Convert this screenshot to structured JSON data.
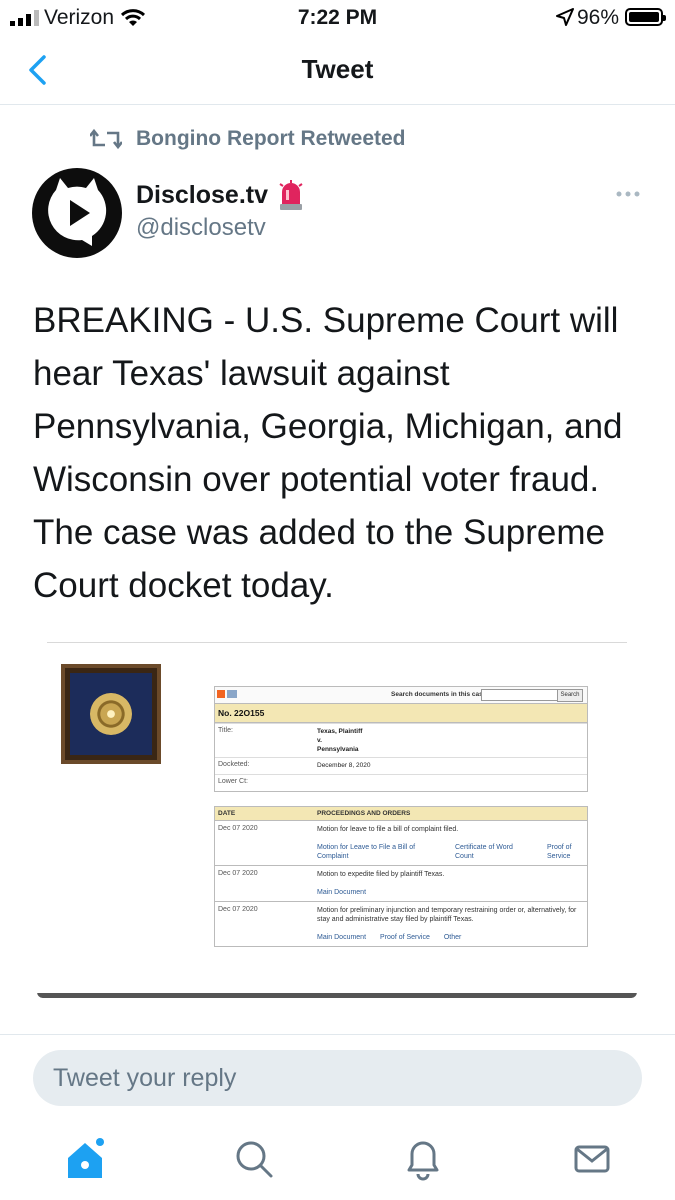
{
  "status_bar": {
    "carrier": "Verizon",
    "time": "7:22 PM",
    "battery": "96%",
    "battery_level": 0.96
  },
  "nav": {
    "title": "Tweet",
    "back_icon": "chevron-left-icon"
  },
  "retweet": {
    "icon": "retweet-icon",
    "text": "Bongino Report Retweeted"
  },
  "author": {
    "name": "Disclose.tv",
    "handle": "@disclosetv",
    "badge_icon": "siren-icon",
    "more_icon": "ellipsis-icon"
  },
  "tweet": {
    "text": "BREAKING - U.S. Supreme Court will hear Texas' lawsuit against Pennsylvania, Georgia, Michigan, and Wisconsin over potential voter fraud. The case was added to the Supreme Court docket today."
  },
  "media": {
    "search_label": "Search documents in this case:",
    "search_button": "Search",
    "docket_no": "No. 22O155",
    "fields": [
      {
        "key": "Title:",
        "value": "Texas, Plaintiff\nv.\nPennsylvania"
      },
      {
        "key": "Docketed:",
        "value": "December 8, 2020"
      },
      {
        "key": "Lower Ct:",
        "value": ""
      }
    ],
    "proceedings_header": {
      "date": "DATE",
      "title": "PROCEEDINGS AND ORDERS"
    },
    "proceedings": [
      {
        "date": "Dec 07 2020",
        "text": "Motion for leave to file a bill of complaint filed.",
        "links": [
          "Motion for Leave to File a Bill of Complaint",
          "Certificate of Word Count",
          "Proof of Service"
        ]
      },
      {
        "date": "Dec 07 2020",
        "text": "Motion to expedite filed by plaintiff Texas.",
        "links": [
          "Main Document"
        ]
      },
      {
        "date": "Dec 07 2020",
        "text": "Motion for preliminary injunction and temporary restraining order or, alternatively, for stay and administrative stay filed by plaintiff Texas.",
        "links": [
          "Main Document",
          "Proof of Service",
          "Other"
        ]
      }
    ]
  },
  "reply": {
    "placeholder": "Tweet your reply"
  },
  "tabbar": {
    "items": [
      "home-icon",
      "search-icon",
      "notifications-icon",
      "messages-icon"
    ]
  },
  "colors": {
    "accent": "#1da1f2",
    "secondary_text": "#657786",
    "reply_bg": "#e6ecf0"
  }
}
